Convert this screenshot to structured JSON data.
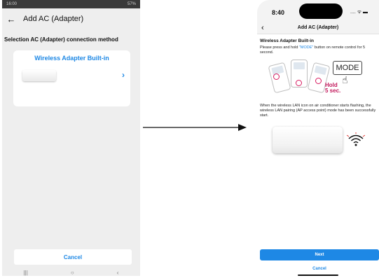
{
  "left": {
    "status": {
      "time": "16:00",
      "right_text": "57%"
    },
    "appbar": {
      "title": "Add AC (Adapter)"
    },
    "section_title": "Selection AC (Adapter) connection method",
    "option": {
      "title": "Wireless Adapter Built-in"
    },
    "cancel_label": "Cancel"
  },
  "right": {
    "status": {
      "time": "8:40"
    },
    "nav": {
      "title": "Add AC (Adapter)"
    },
    "heading": "Wireless Adapter Built-in",
    "instruction": {
      "before": "Please press and hold ",
      "highlight": "\"MODE\"",
      "after": " button on remote control for 5 second."
    },
    "mode_label": "MODE",
    "hold_line1": "Hold",
    "hold_line2": "5 sec.",
    "description": "When the wireless LAN icon on air conditioner starts flashing, the wireless LAN pairing (AP access point) mode has been successfully start.",
    "next_label": "Next",
    "cancel_label": "Cancel"
  },
  "colors": {
    "accent_blue": "#1e88e5",
    "highlight_pink": "#c2185b"
  }
}
